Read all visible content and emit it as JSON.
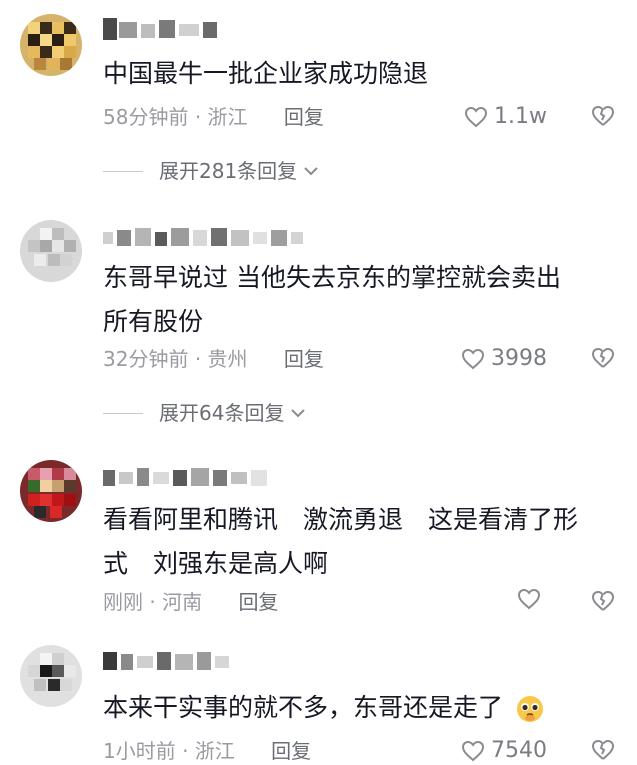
{
  "comments": [
    {
      "text_lines": [
        "中国最牛一批企业家成功隐退"
      ],
      "time": "58分钟前",
      "location": "浙江",
      "reply_label": "回复",
      "likes": "1.1w",
      "expand": "展开281条回复"
    },
    {
      "text_lines": [
        "东哥早说过 当他失去京东的掌控就会卖出",
        "所有股份"
      ],
      "time": "32分钟前",
      "location": "贵州",
      "reply_label": "回复",
      "likes": "3998",
      "expand": "展开64条回复"
    },
    {
      "text_lines": [
        "看看阿里和腾讯　激流勇退　这是看清了形",
        "式　刘强东是高人啊"
      ],
      "time": "刚刚",
      "location": "河南",
      "reply_label": "回复",
      "likes": ""
    },
    {
      "text_lines": [
        "本来干实事的就不多，东哥还是走了"
      ],
      "time": "1小时前",
      "location": "浙江",
      "reply_label": "回复",
      "likes": "7540"
    }
  ],
  "colors": {
    "text": "#161823",
    "meta": "#9a9ba2",
    "icon": "#8a8b91"
  }
}
